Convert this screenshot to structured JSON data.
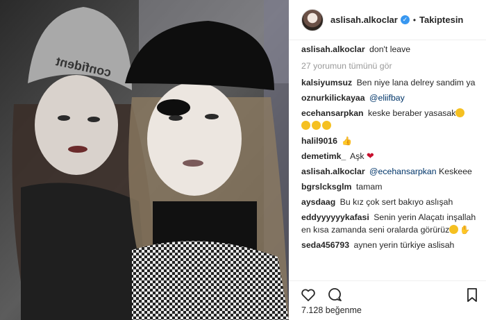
{
  "post": {
    "username": "aslisah.alkoclar",
    "follow_status": "Takiptesin",
    "separator": "•",
    "verified_mark": "✓",
    "view_all_comments": "27 yorumun tümünü gör",
    "likes": "7.128 beğenme"
  },
  "caption": {
    "user": "aslisah.alkoclar",
    "text": "don't leave"
  },
  "comments": [
    {
      "user": "kalsiyumsuz",
      "text": "Ben niye lana delrey sandim ya"
    },
    {
      "user": "oznurkilickayaa",
      "mention": "@eliifbay",
      "text": ""
    },
    {
      "user": "ecehansarpkan",
      "text": "keske beraber yasasak"
    },
    {
      "user": "halil9016",
      "text": ""
    },
    {
      "user": "demetimk_",
      "text": "Aşk"
    },
    {
      "user": "aslisah.alkoclar",
      "mention": "@ecehansarpkan",
      "text": "Keskeee"
    },
    {
      "user": "bgrslcksglm",
      "text": "tamam"
    },
    {
      "user": "aysdaag",
      "text": "Bu kız çok sert bakıyo aslışah"
    },
    {
      "user": "eddyyyyyykafasi",
      "text": "Senin yerin Alaçatı inşallah en kısa zamanda seni oralarda görürüz"
    },
    {
      "user": "seda456793",
      "text": "aynen yerin türkiye aslisah"
    }
  ],
  "photo_text": {
    "beanie": "confident"
  },
  "icons": {
    "like": "heart-icon",
    "comment": "comment-icon",
    "save": "bookmark-icon",
    "verified": "verified-badge-icon"
  },
  "colors": {
    "verified": "#3897f0",
    "mention": "#003569",
    "muted": "#999999",
    "heart": "#c8102e"
  }
}
